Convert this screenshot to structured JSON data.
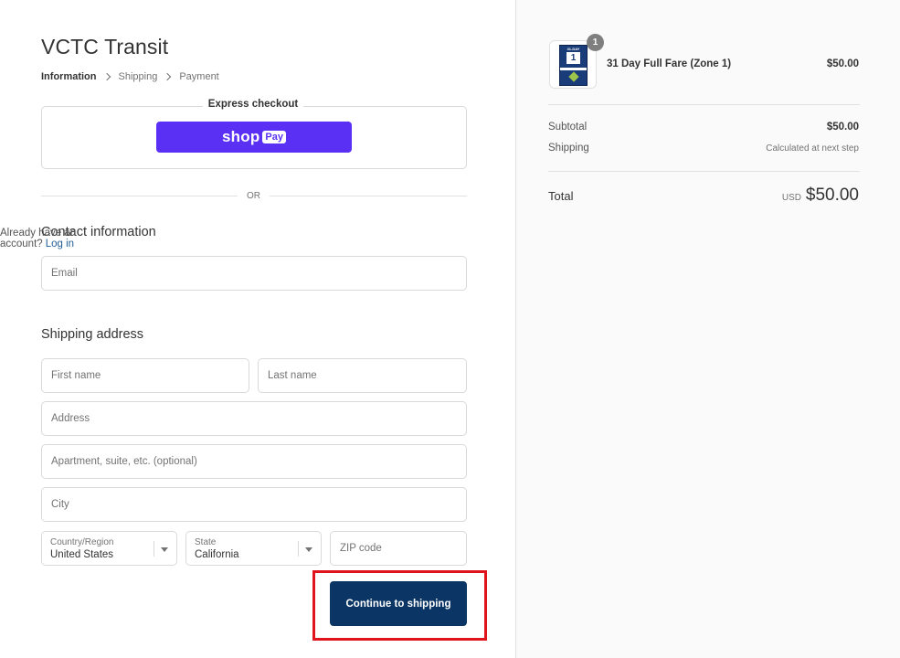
{
  "store": {
    "title": "VCTC Transit"
  },
  "breadcrumb": {
    "items": [
      "Information",
      "Shipping",
      "Payment"
    ]
  },
  "express": {
    "label": "Express checkout",
    "shop_word": "shop",
    "pay_word": "Pay"
  },
  "divider": {
    "or": "OR"
  },
  "contact": {
    "title": "Contact information",
    "account_prompt": "Already have an account?",
    "login_link": "Log in",
    "email_placeholder": "Email"
  },
  "shipping": {
    "title": "Shipping address",
    "first_name_placeholder": "First name",
    "last_name_placeholder": "Last name",
    "address_placeholder": "Address",
    "apartment_placeholder": "Apartment, suite, etc. (optional)",
    "city_placeholder": "City",
    "country_label": "Country/Region",
    "country_value": "United States",
    "state_label": "State",
    "state_value": "California",
    "zip_placeholder": "ZIP code"
  },
  "actions": {
    "continue_label": "Continue to shipping"
  },
  "colors": {
    "accent": "#0b3564",
    "shop_pay": "#5a31f4",
    "highlight": "#e0141c",
    "link": "#1f5e97"
  },
  "order": {
    "product": {
      "name": "31 Day Full Fare (Zone 1)",
      "price": "$50.00",
      "quantity": "1",
      "ticket_top": "31-DAY",
      "ticket_number": "1"
    },
    "subtotal_label": "Subtotal",
    "subtotal_value": "$50.00",
    "shipping_label": "Shipping",
    "shipping_value": "Calculated at next step",
    "total_label": "Total",
    "total_currency": "USD",
    "total_value": "$50.00"
  }
}
